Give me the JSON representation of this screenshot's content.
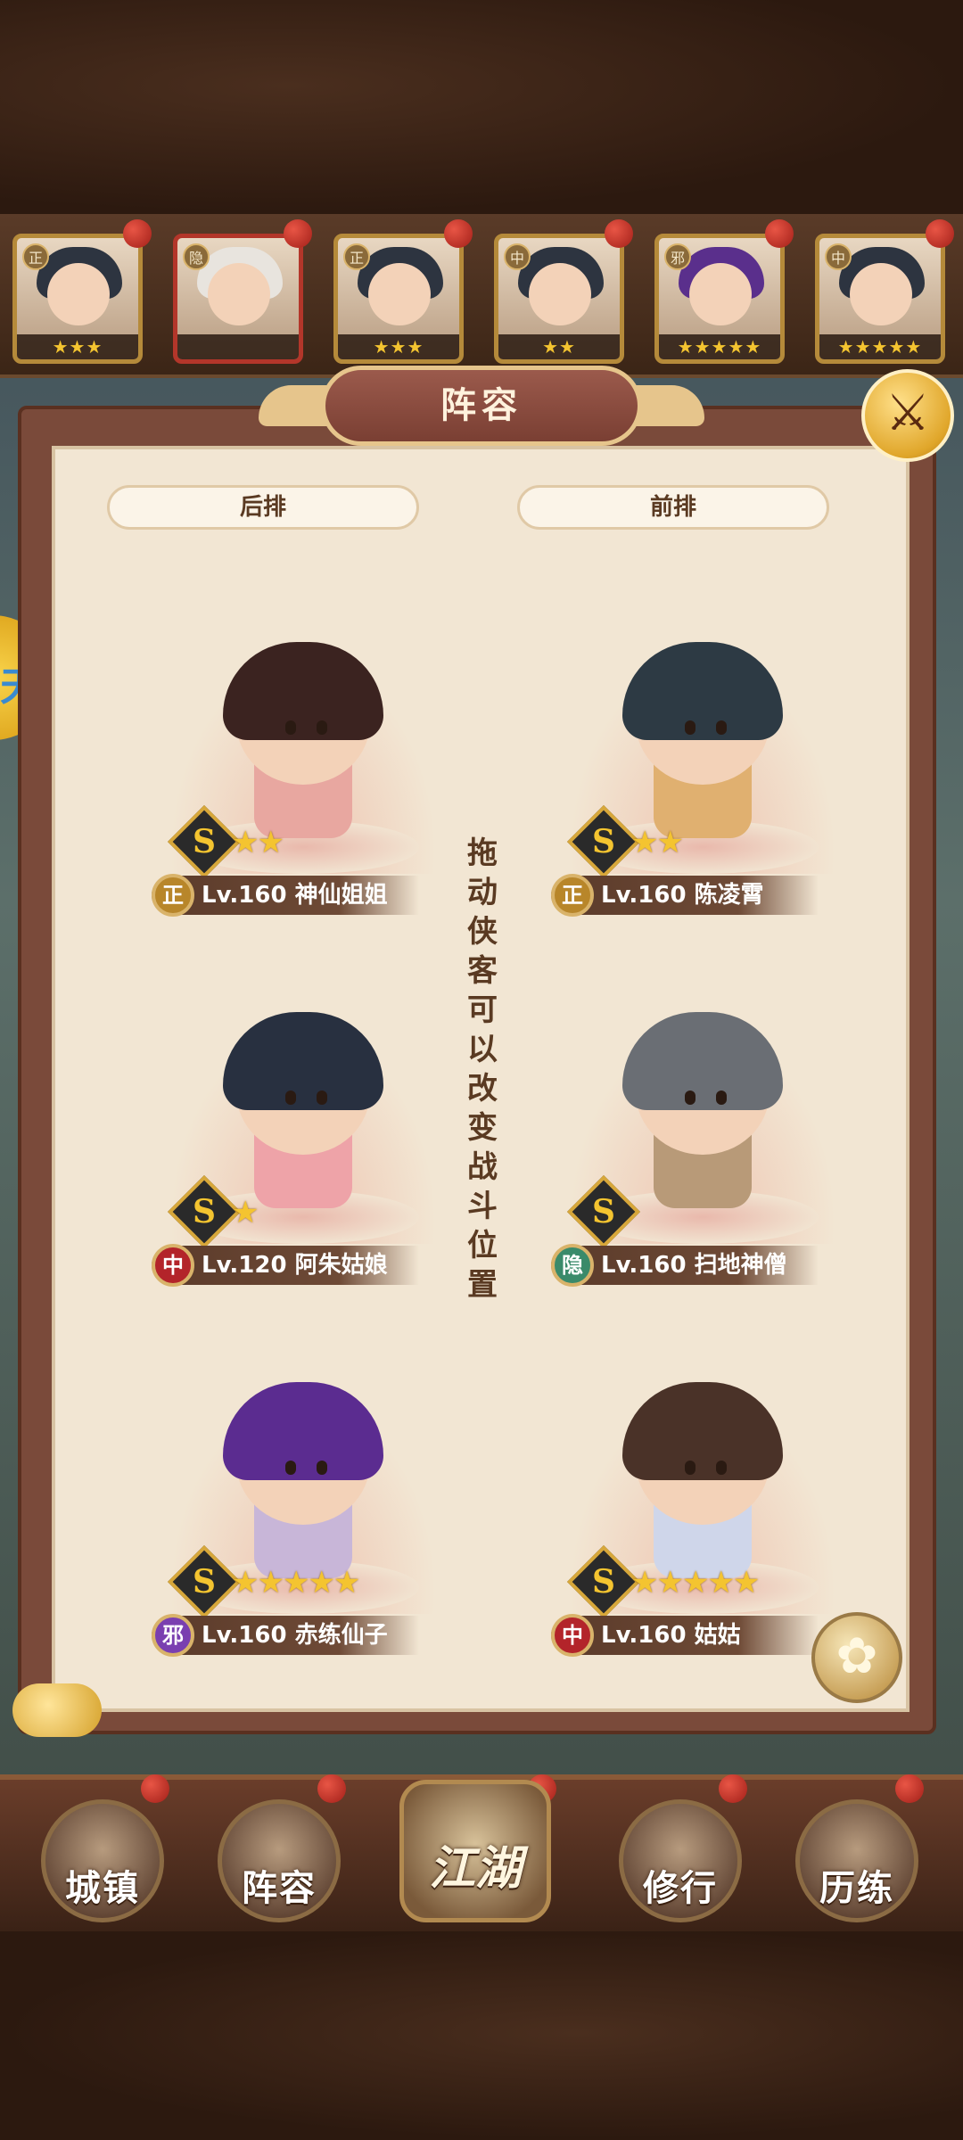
{
  "panel": {
    "title": "阵容",
    "back_row_label": "后排",
    "front_row_label": "前排",
    "hint_chars": [
      "拖",
      "动",
      "侠",
      "客",
      "可",
      "以",
      "改",
      "变",
      "战",
      "斗",
      "位",
      "置"
    ]
  },
  "roster": [
    {
      "faction": "正",
      "stars": "★★★",
      "hair": "dark"
    },
    {
      "faction": "隐",
      "stars": "",
      "hair": "white"
    },
    {
      "faction": "正",
      "stars": "★★★",
      "hair": "dark"
    },
    {
      "faction": "中",
      "stars": "★★",
      "hair": "dark"
    },
    {
      "faction": "邪",
      "stars": "★★★★★",
      "hair": "purple"
    },
    {
      "faction": "中",
      "stars": "★★★★★",
      "hair": "dark"
    }
  ],
  "heroes": {
    "back": [
      {
        "name": "Lv.160 神仙姐姐",
        "faction": "正",
        "faction_color": "#b8862a",
        "stars": "★★",
        "hair": "#3b2320",
        "outfit": "#e8a7a0"
      },
      {
        "name": "Lv.120 阿朱姑娘",
        "faction": "中",
        "faction_color": "#b3242a",
        "stars": "★",
        "hair": "#283040",
        "outfit": "#eea3a8"
      },
      {
        "name": "Lv.160 赤练仙子",
        "faction": "邪",
        "faction_color": "#7a3fb0",
        "stars": "★★★★★",
        "hair": "#5b2c90",
        "outfit": "#c8b6d8"
      }
    ],
    "front": [
      {
        "name": "Lv.160 陈凌霄",
        "faction": "正",
        "faction_color": "#b8862a",
        "stars": "★★",
        "hair": "#2d3a44",
        "outfit": "#e0b070"
      },
      {
        "name": "Lv.160 扫地神僧",
        "faction": "隐",
        "faction_color": "#3a8a6a",
        "stars": "",
        "hair": "#6a6e74",
        "outfit": "#b89a78"
      },
      {
        "name": "Lv.160 姑姑",
        "faction": "中",
        "faction_color": "#b3242a",
        "stars": "★★★★★",
        "hair": "#4a3228",
        "outfit": "#cfd6ea"
      }
    ]
  },
  "rank": "S",
  "nav": {
    "town": "城镇",
    "lineup": "阵容",
    "jianghu": "江湖",
    "cultivate": "修行",
    "trial": "历练"
  }
}
